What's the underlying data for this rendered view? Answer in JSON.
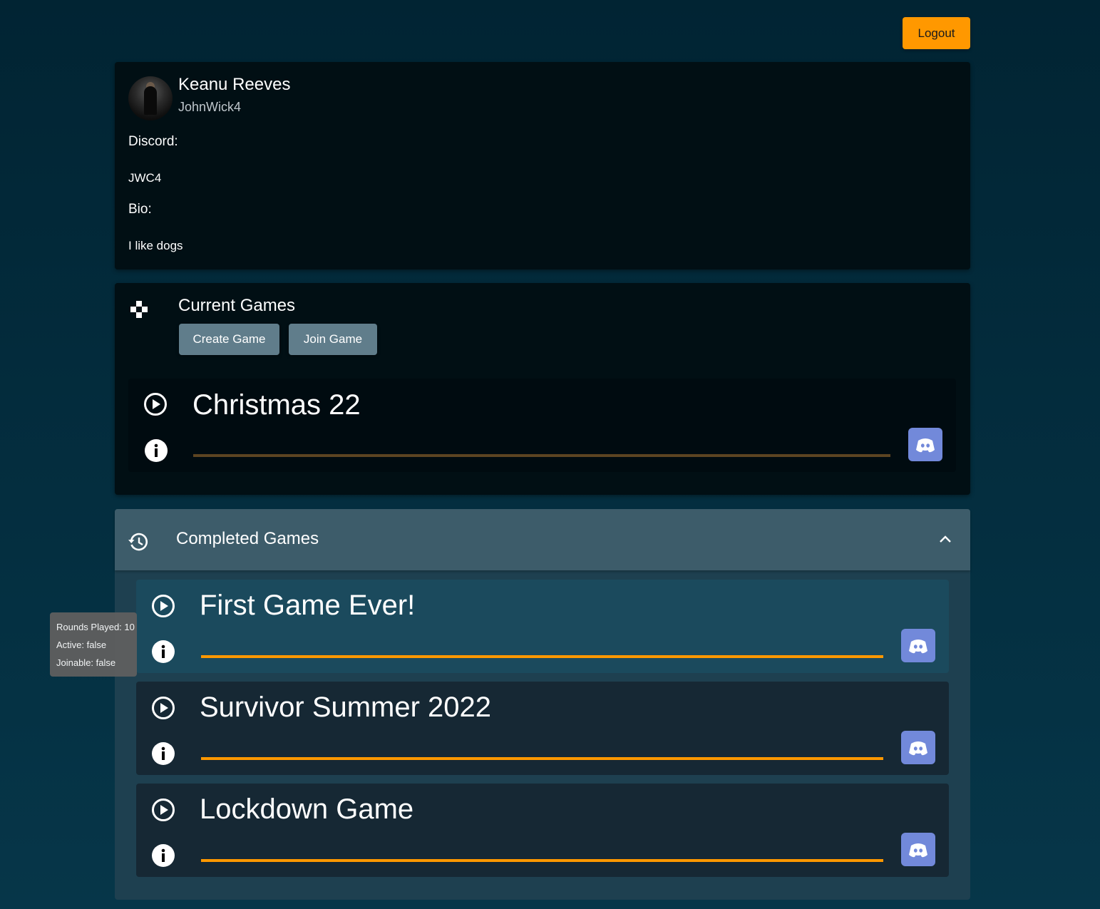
{
  "header": {
    "logout_label": "Logout"
  },
  "profile": {
    "name": "Keanu Reeves",
    "username": "JohnWick4",
    "discord_label": "Discord:",
    "discord_value": "JWC4",
    "bio_label": "Bio:",
    "bio_value": "I like dogs"
  },
  "current_games": {
    "title": "Current Games",
    "create_label": "Create Game",
    "join_label": "Join Game",
    "games": [
      {
        "name": "Christmas 22",
        "progress": 1.0,
        "bar_color": "#5c4422"
      }
    ]
  },
  "completed_games": {
    "title": "Completed Games",
    "games": [
      {
        "name": "First Game Ever!",
        "progress": 1.0,
        "bar_color": "#ff9800"
      },
      {
        "name": "Survivor Summer 2022",
        "progress": 1.0,
        "bar_color": "#ff9800"
      },
      {
        "name": "Lockdown Game",
        "progress": 1.0,
        "bar_color": "#ff9800"
      }
    ]
  },
  "tooltip": {
    "rounds": "Rounds Played: 10",
    "active": "Active: false",
    "joinable": "Joinable: false"
  },
  "colors": {
    "accent": "#ff9800",
    "discord": "#7289da",
    "button": "#607d8b"
  },
  "icons": [
    "gamepad-icon",
    "history-icon",
    "chevron-up-icon",
    "play-circle-icon",
    "info-icon",
    "discord-icon"
  ]
}
